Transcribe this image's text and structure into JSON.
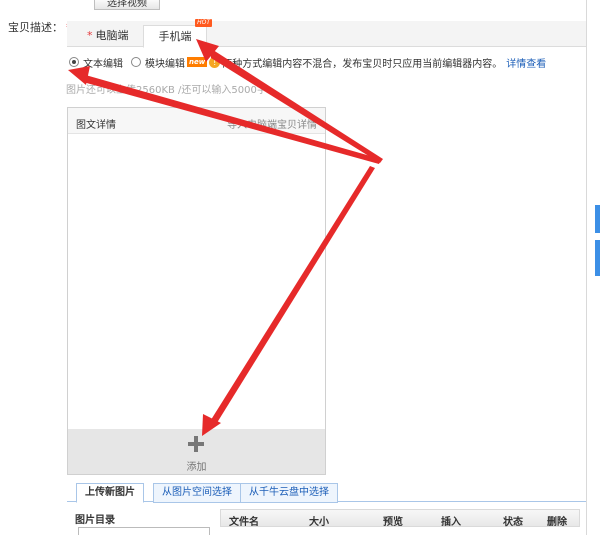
{
  "top_button": {
    "label": "选择视频"
  },
  "description_field": {
    "label": "宝贝描述：",
    "required_mark": "*"
  },
  "device_tabs": [
    {
      "label": "电脑端",
      "required_mark": "*"
    },
    {
      "label": "手机端",
      "badge": "HOT"
    }
  ],
  "edit_modes": {
    "text_edit": {
      "label": "文本编辑",
      "selected": true
    },
    "module_edit": {
      "label": "模块编辑",
      "selected": false,
      "badge": "new"
    },
    "note": "两种方式编辑内容不混合，发布宝贝时只应用当前编辑器内容。",
    "detail_link": "详情查看"
  },
  "limit_note": "图片还可以上传2560KB /还可以输入5000字",
  "editor": {
    "title": "图文详情",
    "import_link": "导入电脑端宝贝详情",
    "add_label": "添加"
  },
  "upload_tabs": [
    "上传新图片",
    "从图片空间选择",
    "从千牛云盘中选择"
  ],
  "folder_title": "图片目录",
  "file_table_columns": [
    "文件名",
    "大小",
    "预览",
    "插入",
    "状态",
    "删除"
  ],
  "colors": {
    "arrow": "#e62a2a",
    "link": "#1d5fb8",
    "required": "#e4393c",
    "accent_bar": "#3c8fe6"
  }
}
